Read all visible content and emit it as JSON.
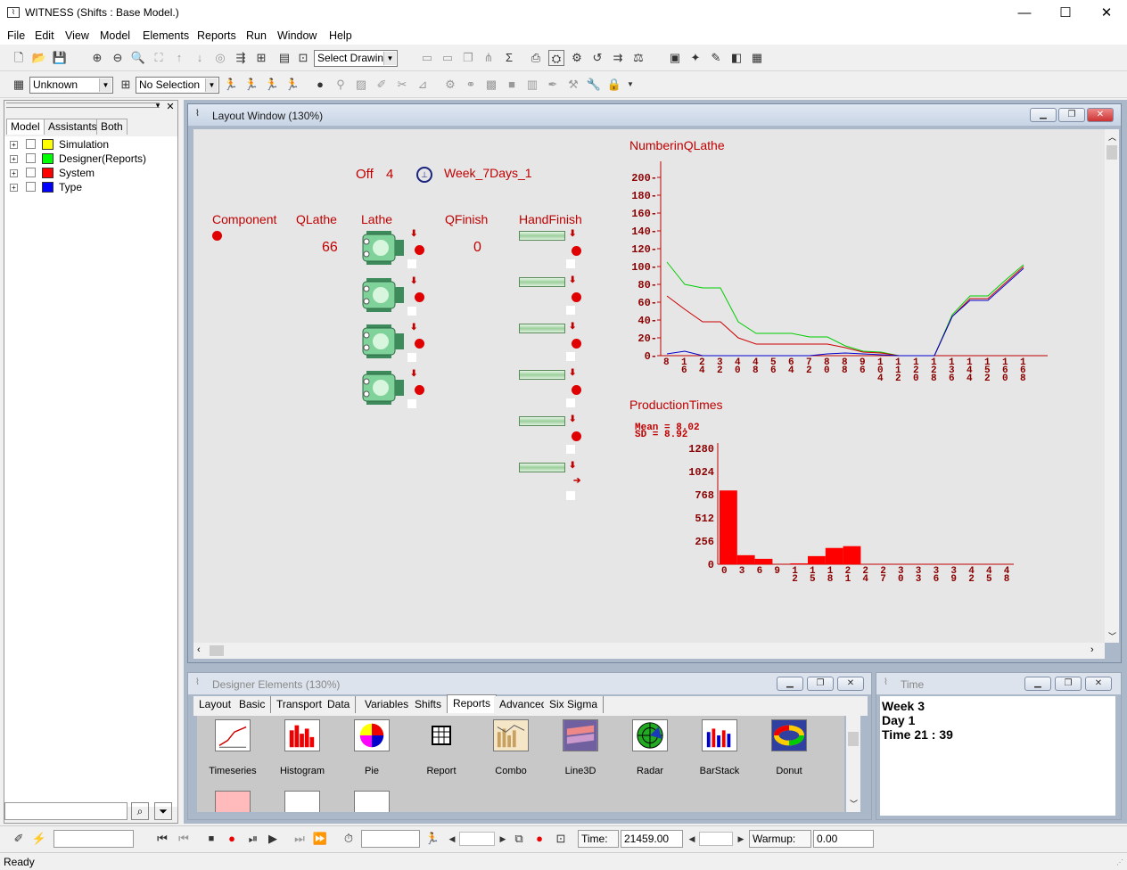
{
  "app": {
    "title": "WITNESS (Shifts : Base Model.)"
  },
  "menu": [
    "File",
    "Edit",
    "View",
    "Model",
    "Elements",
    "Reports",
    "Run",
    "Window",
    "Help"
  ],
  "toolbar": {
    "drawing_select": "Select Drawing",
    "unknown_select": "Unknown",
    "selection_select": "No Selection"
  },
  "left_panel": {
    "tabs": [
      "Model",
      "Assistants",
      "Both"
    ],
    "tree": [
      {
        "label": "Simulation",
        "color": "#ffff00"
      },
      {
        "label": "Designer(Reports)",
        "color": "#00ff00"
      },
      {
        "label": "System",
        "color": "#ff0000"
      },
      {
        "label": "Type",
        "color": "#0000ff"
      }
    ],
    "search_value": ""
  },
  "layout_window": {
    "title": "Layout Window (130%)",
    "shift_state": "Off",
    "shift_value": "4",
    "shift_name": "Week_7Days_1",
    "labels": {
      "component": "Component",
      "qlathe": "QLathe",
      "lathe": "Lathe",
      "qfinish": "QFinish",
      "handfinish": "HandFinish"
    },
    "qlathe_value": "66",
    "qfinish_value": "0"
  },
  "chart_data": [
    {
      "type": "line",
      "title": "NumberinQLathe",
      "ylim": [
        0,
        200
      ],
      "yticks": [
        "200",
        "180",
        "160",
        "140",
        "120",
        "100",
        "80",
        "60",
        "40",
        "20",
        "0"
      ],
      "x_tick_labels": [
        "8",
        "16",
        "24",
        "32",
        "40",
        "48",
        "56",
        "64",
        "72",
        "80",
        "88",
        "96",
        "104",
        "112",
        "120",
        "128",
        "136",
        "144",
        "152",
        "160",
        "168"
      ],
      "x": [
        8,
        16,
        24,
        32,
        40,
        48,
        56,
        64,
        72,
        80,
        88,
        96,
        104,
        112,
        120,
        128,
        136,
        144,
        152,
        160,
        168
      ],
      "series": [
        {
          "color": "#00cc00",
          "values": [
            105,
            80,
            76,
            76,
            38,
            25,
            25,
            25,
            21,
            21,
            11,
            5,
            4,
            0,
            0,
            0,
            46,
            67,
            67,
            85,
            102
          ]
        },
        {
          "color": "#cc0000",
          "values": [
            67,
            52,
            38,
            38,
            20,
            13,
            13,
            13,
            13,
            13,
            9,
            4,
            3,
            0,
            0,
            0,
            44,
            64,
            64,
            82,
            100
          ]
        },
        {
          "color": "#0000cc",
          "values": [
            2,
            5,
            0,
            0,
            0,
            0,
            0,
            0,
            0,
            2,
            3,
            2,
            1,
            0,
            0,
            0,
            44,
            62,
            62,
            80,
            98
          ]
        }
      ]
    },
    {
      "type": "bar",
      "title": "ProductionTimes",
      "annotations": [
        "Mean = 8.02",
        "SD = 8.92"
      ],
      "ylim": [
        0,
        1280
      ],
      "yticks": [
        "1280",
        "1024",
        "768",
        "512",
        "256",
        "0"
      ],
      "x_tick_labels": [
        "0",
        "3",
        "6",
        "9",
        "12",
        "15",
        "18",
        "21",
        "24",
        "27",
        "30",
        "33",
        "36",
        "39",
        "42",
        "45",
        "48"
      ],
      "values": [
        815,
        100,
        60,
        0,
        10,
        90,
        180,
        200,
        0,
        0,
        0,
        0,
        0,
        0,
        0,
        0
      ],
      "color": "#ff0000"
    }
  ],
  "designer": {
    "title": "Designer Elements (130%)",
    "tabs": [
      "Layout",
      "Basic",
      "Transport",
      "Data",
      "Variables",
      "Shifts",
      "Reports",
      "Advanced",
      "Six Sigma"
    ],
    "active_tab": "Reports",
    "items": [
      "Timeseries",
      "Histogram",
      "Pie",
      "Report",
      "Combo",
      "Line3D",
      "Radar",
      "BarStack",
      "Donut"
    ]
  },
  "time_window": {
    "title": "Time",
    "week_label": "Week",
    "week": "3",
    "day_label": "Day",
    "day": "1",
    "time_label": "Time",
    "time": "21 : 39"
  },
  "runbar": {
    "time_label": "Time:",
    "time_value": "21459.00",
    "warmup_label": "Warmup:",
    "warmup_value": "0.00"
  },
  "status": "Ready"
}
